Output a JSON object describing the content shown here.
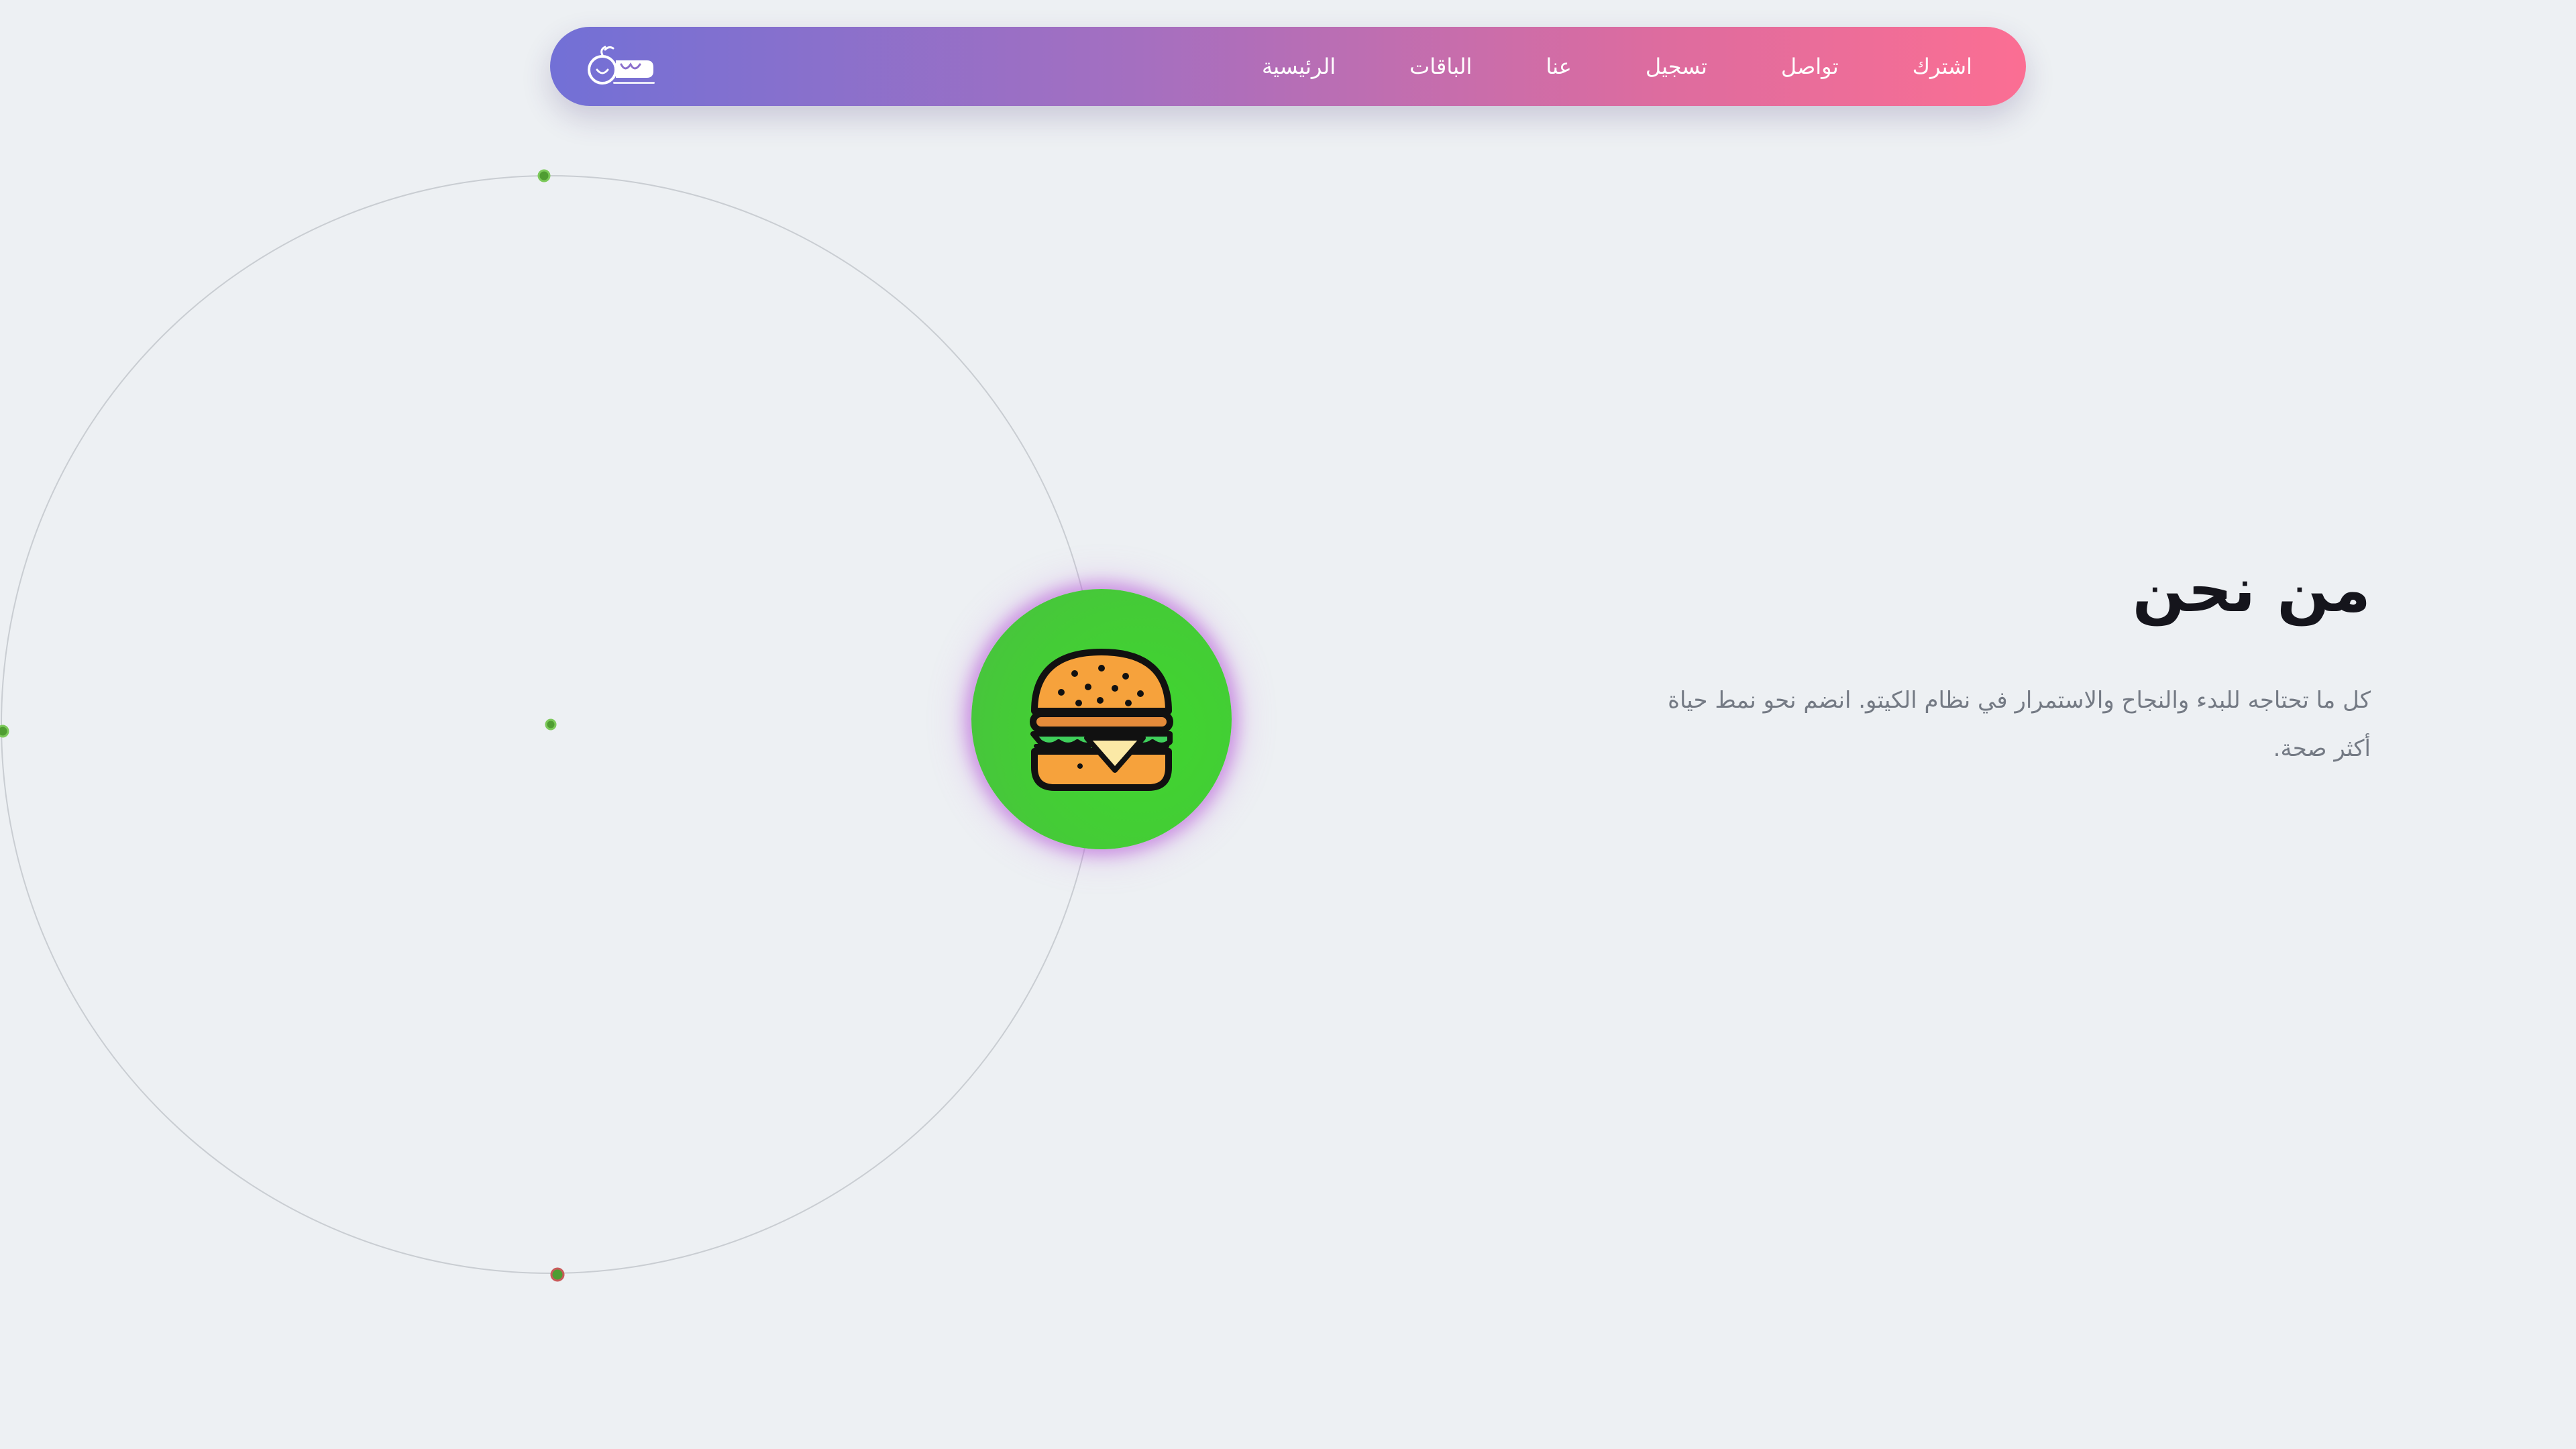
{
  "nav": {
    "items": [
      {
        "label": "اشترك"
      },
      {
        "label": "تواصل"
      },
      {
        "label": "تسجيل"
      },
      {
        "label": "عنا"
      },
      {
        "label": "الباقات"
      },
      {
        "label": "الرئيسية"
      }
    ],
    "logo_icon": "keto-apple-logo"
  },
  "hero": {
    "badge_icon": "burger-icon"
  },
  "about": {
    "title": "من نحن",
    "description": "كل ما تحتاجه للبدء والنجاح والاستمرار في نظام الكيتو. انضم نحو نمط حياة أكثر صحة."
  },
  "colors": {
    "nav_gradient_start": "#7270d6",
    "nav_gradient_end": "#fb6e93",
    "badge_green": "#44cc36",
    "background": "#edf0f3",
    "title": "#15151c",
    "body_text": "#747a84"
  }
}
